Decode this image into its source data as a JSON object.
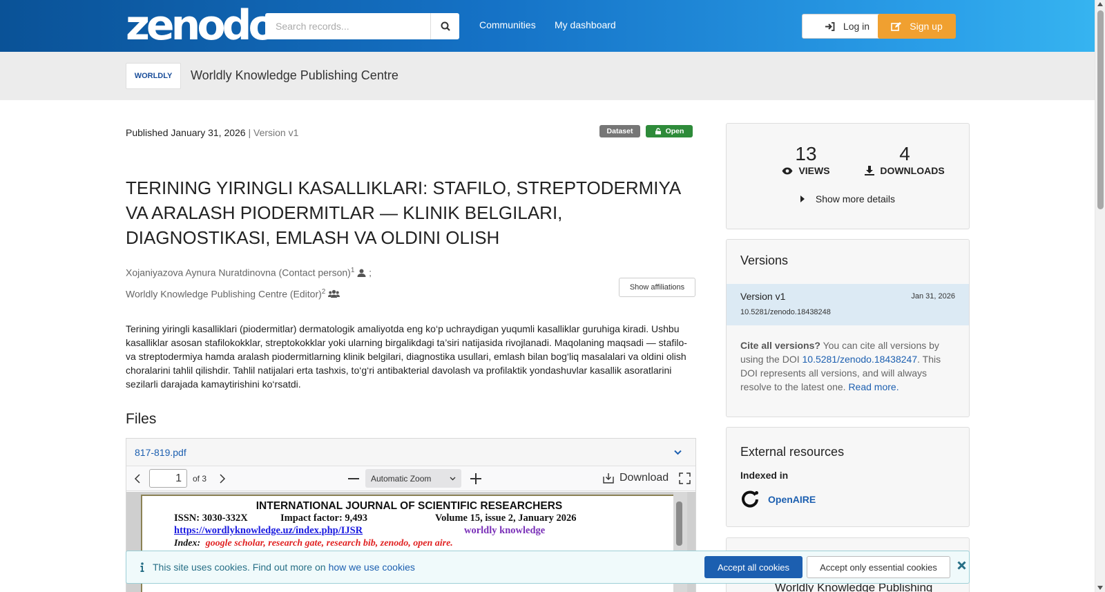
{
  "header": {
    "logo": "zenodo",
    "search_placeholder": "Search records...",
    "nav": [
      "Communities",
      "My dashboard"
    ],
    "login": "Log in",
    "signup": "Sign up"
  },
  "community": {
    "logo_text": "WORLDLY",
    "name": "Worldly Knowledge Publishing Centre"
  },
  "record": {
    "published_label": "Published",
    "published_date": "January 31, 2026",
    "version": "| Version v1",
    "badge_type": "Dataset",
    "badge_access": "Open",
    "title": "TERINING YIRINGLI KASALLIKLARI: STAFILO, STREPTODERMIYA VA ARALASH PIODERMITLAR — KLINIK BELGILARI, DIAGNOSTIKASI, EMLASH VA OLDINI OLISH",
    "creators": [
      {
        "name": "Xojaniyazova Aynura Nuratdinovna (Contact person)",
        "sup": "1",
        "sep": " ;"
      },
      {
        "name": "Worldly Knowledge Publishing Centre (Editor)",
        "sup": "2",
        "sep": ""
      }
    ],
    "show_affiliations": "Show affiliations",
    "abstract": "Terining yiringli kasalliklari (piodermitlar) dermatologik amaliyotda eng ko‘p uchraydigan yuqumli kasalliklar guruhiga kiradi. Ushbu kasalliklar asosan stafilokokklar, streptokokklar yoki ularning birgalikdagi ta’siri natijasida rivojlanadi. Maqolaning maqsadi — stafilo- va streptodermiya hamda aralash piodermitlarning klinik belgilari, diagnostika usullari, emlash bilan bog‘liq masalalari va oldini olish choralarini tahlil qilishdir. Tahlil natijalari erta tashxis, to‘g‘ri antibakterial davolash va profilaktik yondashuvlar kasallik asoratlarini sezilarli darajada kamaytirishini ko‘rsatdi."
  },
  "files": {
    "heading": "Files",
    "filename": "817-819.pdf",
    "page_current": "1",
    "page_total": "of 3",
    "zoom": "Automatic Zoom",
    "download": "Download",
    "pdf": {
      "journal": "INTERNATIONAL JOURNAL OF SCIENTIFIC RESEARCHERS",
      "issn": "ISSN: 3030-332X",
      "impact": "Impact factor: 9,493",
      "volume": "Volume 15, issue 2, January 2026",
      "url": "https://wordlyknowledge.uz/index.php/IJSR",
      "brand": "worldly knowledge",
      "index_label": "Index:",
      "index_list": "google scholar, research gate, research bib, zenodo, open aire."
    }
  },
  "stats": {
    "views": "13",
    "views_label": "VIEWS",
    "downloads": "4",
    "downloads_label": "DOWNLOADS",
    "show_more": "Show more details"
  },
  "versions": {
    "heading": "Versions",
    "item_label": "Version v1",
    "item_date": "Jan 31, 2026",
    "item_doi": "10.5281/zenodo.18438248",
    "cite_bold": "Cite all versions?",
    "cite_text1": " You can cite all versions by using the DOI ",
    "cite_doi": "10.5281/zenodo.18438247",
    "cite_text2": ". This DOI represents all versions, and will always resolve to the latest one. ",
    "read_more": "Read more."
  },
  "external": {
    "heading": "External resources",
    "indexed_in": "Indexed in",
    "openaire": "OpenAIRE"
  },
  "next_card_title": "Worldly Knowledge Publishing",
  "cookie": {
    "text": "This site uses cookies. Find out more on ",
    "link": "how we use cookies",
    "accept_all": "Accept all cookies",
    "accept_essential": "Accept only essential cookies"
  },
  "colors": {
    "header_start": "#0a5297",
    "header_end": "#36b4f0",
    "signup": "#f0a030",
    "badge_dataset": "#767676",
    "badge_open": "#2e8b3a",
    "link": "#1c5fb0"
  }
}
